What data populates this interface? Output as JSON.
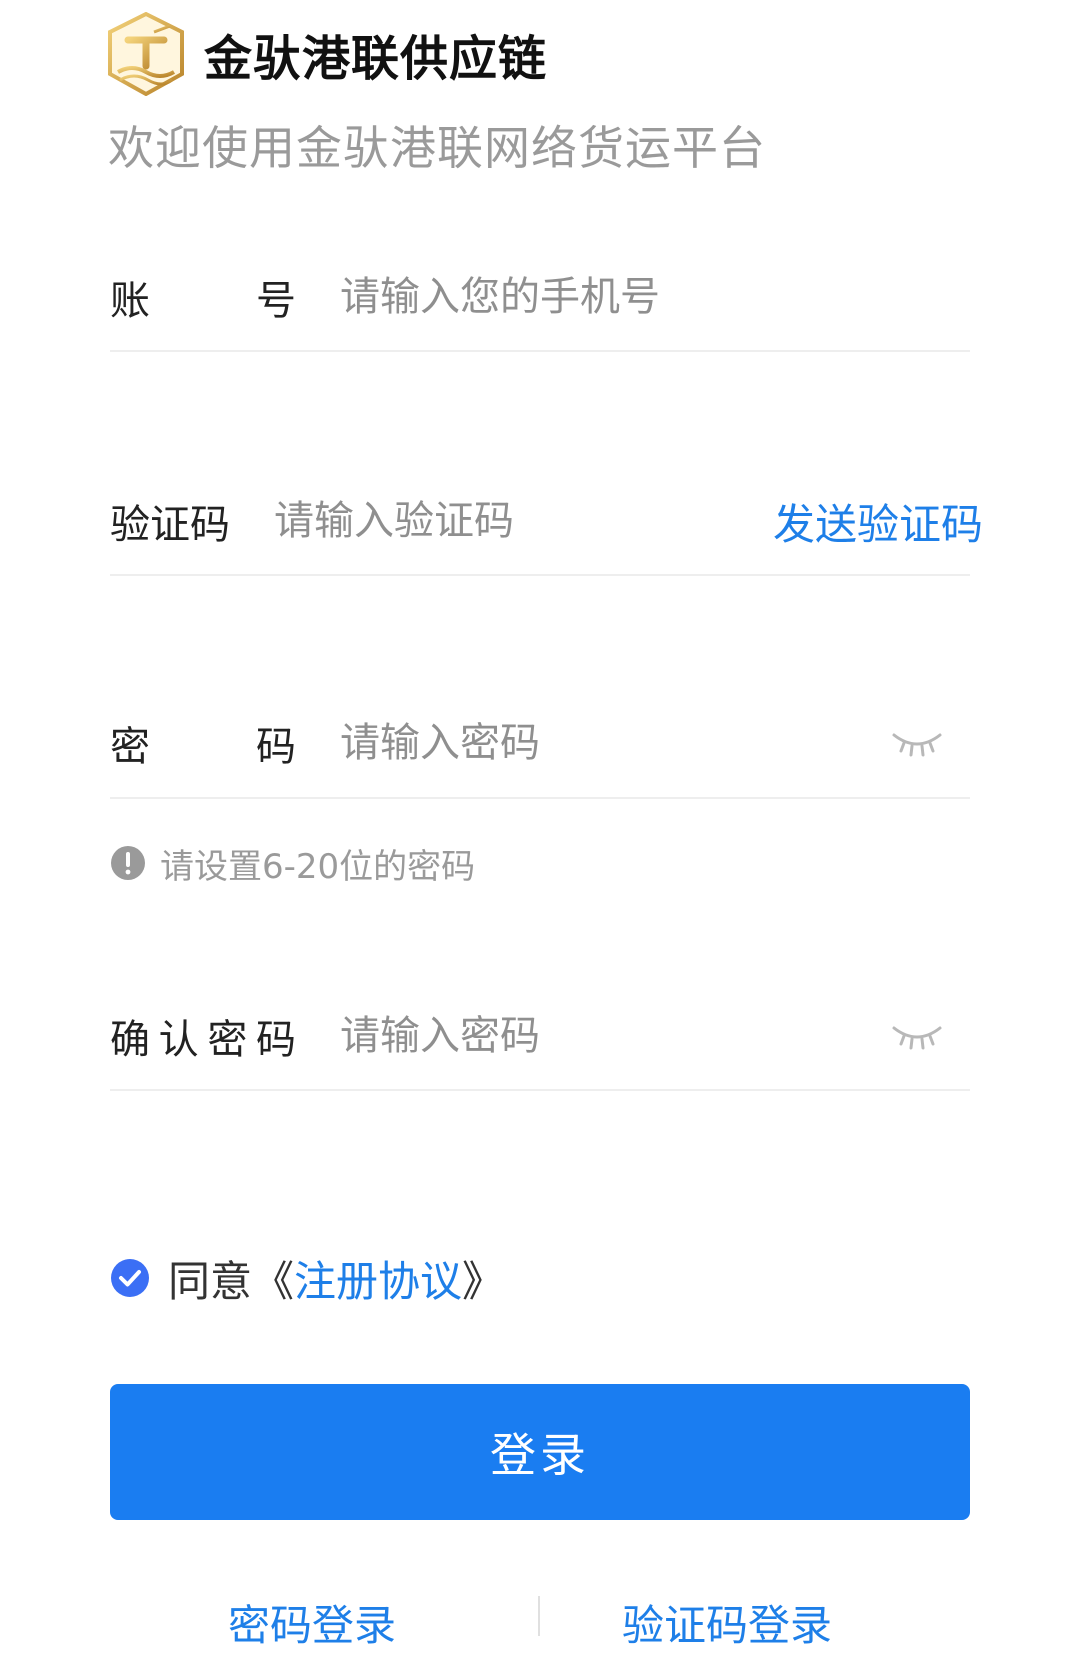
{
  "brand": {
    "name": "金驮港联供应链",
    "welcome": "欢迎使用金驮港联网络货运平台"
  },
  "form": {
    "account": {
      "label_chars": [
        "账",
        "号"
      ],
      "placeholder": "请输入您的手机号"
    },
    "code": {
      "label_chars": [
        "验",
        "证",
        "码"
      ],
      "placeholder": "请输入验证码",
      "send_label": "发送验证码"
    },
    "password": {
      "label_chars": [
        "密",
        "码"
      ],
      "placeholder": "请输入密码",
      "hint": "请设置6-20位的密码"
    },
    "confirm": {
      "label_chars": [
        "确",
        "认",
        "密",
        "码"
      ],
      "placeholder": "请输入密码"
    }
  },
  "agreement": {
    "checked": true,
    "prefix": "同意",
    "open": "《",
    "link": "注册协议",
    "close": "》"
  },
  "login_button": "登录",
  "bottom_tabs": {
    "password_login": "密码登录",
    "code_login": "验证码登录"
  },
  "colors": {
    "accent": "#1a7df1",
    "link": "#1e7fe8",
    "placeholder": "#8f8f8f",
    "check": "#3b6ff5"
  },
  "icons": {
    "logo": "brand-logo",
    "eye": "eye-closed-icon",
    "hint": "exclamation-circle-icon",
    "check": "check-circle-icon"
  }
}
